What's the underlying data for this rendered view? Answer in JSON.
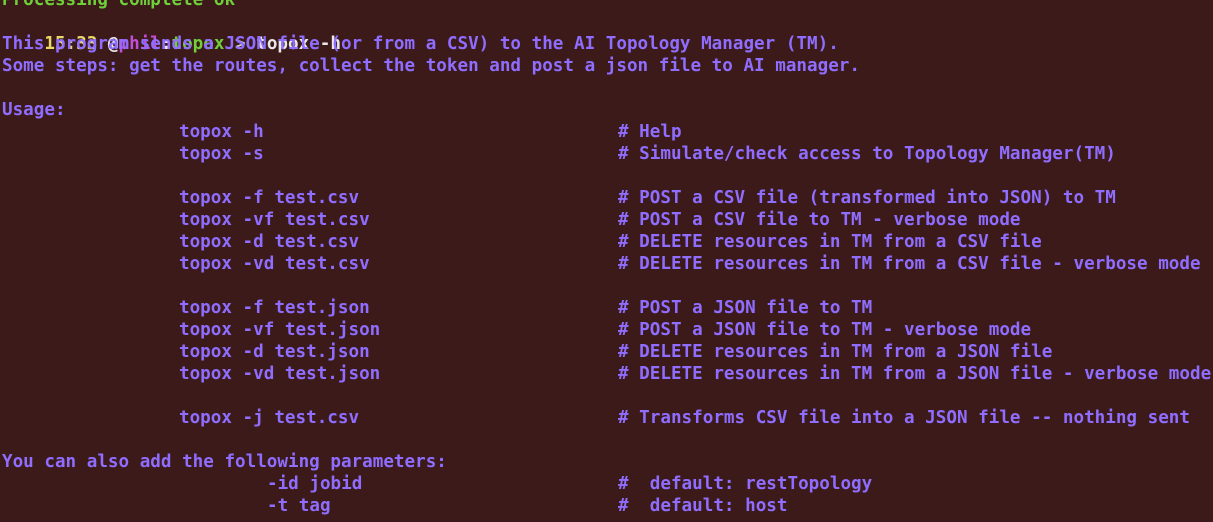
{
  "terminal": {
    "colors": {
      "background": "#3c1a1a",
      "text": "#8f6dff",
      "time": "#e8d96a",
      "user": "#c44fd6",
      "host": "#6fd03a",
      "command": "#e8e8e8"
    },
    "top_partial": "Processing complete ok",
    "prompt": {
      "time": "15:33",
      "at": " @",
      "user": "phil",
      "colon": ":",
      "host": "topox",
      "arrow": " > ",
      "command": "topox -h"
    },
    "intro": [
      "This program sends a JSON file (or from a CSV) to the AI Topology Manager (TM).",
      "Some steps: get the routes, collect the token and post a json file to AI manager."
    ],
    "usage_title": "Usage:",
    "usage": [
      {
        "cmd": "topox -h",
        "comment": "# Help"
      },
      {
        "cmd": "topox -s",
        "comment": "# Simulate/check access to Topology Manager(TM)"
      },
      {
        "cmd": "topox -f test.csv",
        "comment": "# POST a CSV file (transformed into JSON) to TM"
      },
      {
        "cmd": "topox -vf test.csv",
        "comment": "# POST a CSV file to TM - verbose mode"
      },
      {
        "cmd": "topox -d test.csv",
        "comment": "# DELETE resources in TM from a CSV file"
      },
      {
        "cmd": "topox -vd test.csv",
        "comment": "# DELETE resources in TM from a CSV file - verbose mode"
      },
      {
        "cmd": "topox -f test.json",
        "comment": "# POST a JSON file to TM"
      },
      {
        "cmd": "topox -vf test.json",
        "comment": "# POST a JSON file to TM - verbose mode"
      },
      {
        "cmd": "topox -d test.json",
        "comment": "# DELETE resources in TM from a JSON file"
      },
      {
        "cmd": "topox -vd test.json",
        "comment": "# DELETE resources in TM from a JSON file - verbose mode"
      },
      {
        "cmd": "topox -j test.csv",
        "comment": "# Transforms CSV file into a JSON file -- nothing sent"
      }
    ],
    "params_title": "You can also add the following parameters:",
    "params": [
      {
        "param": "-id jobid",
        "comment": "#  default: restTopology"
      },
      {
        "param": "-t tag",
        "comment": "#  default: host"
      }
    ]
  }
}
